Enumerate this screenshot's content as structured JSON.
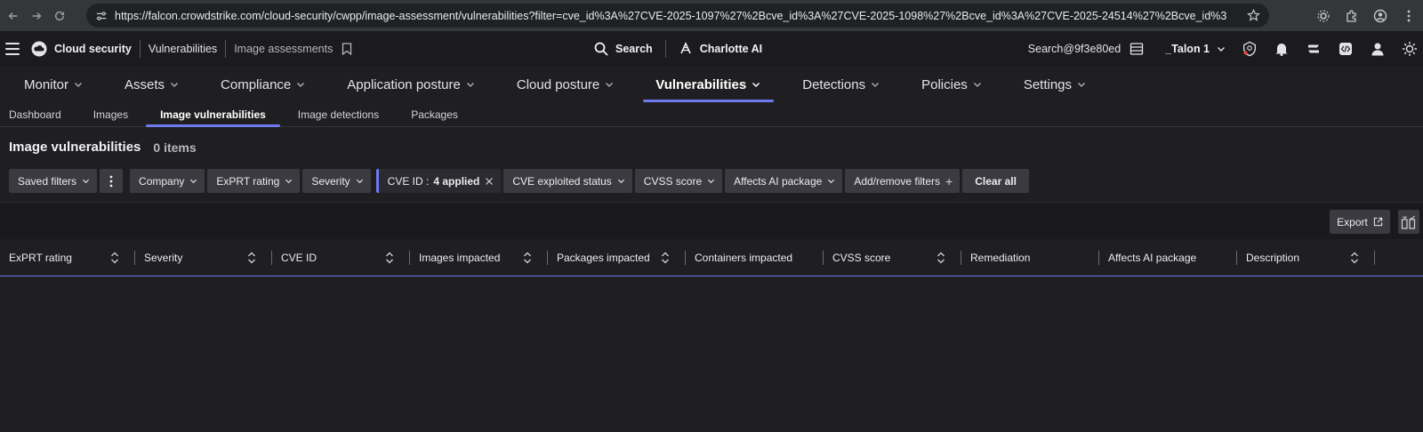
{
  "browser": {
    "url": "https://falcon.crowdstrike.com/cloud-security/cwpp/image-assessment/vulnerabilities?filter=cve_id%3A%27CVE-2025-1097%27%2Bcve_id%3A%27CVE-2025-1098%27%2Bcve_id%3A%27CVE-2025-24514%27%2Bcve_id%3A..."
  },
  "header": {
    "app_name": "Cloud security",
    "crumb": "Vulnerabilities",
    "crumb_sub": "Image assessments",
    "search_label": "Search",
    "ai_label": "Charlotte AI",
    "user_search": "Search@9f3e80ed",
    "tenant": "_Talon 1"
  },
  "main_nav": [
    {
      "label": "Monitor"
    },
    {
      "label": "Assets"
    },
    {
      "label": "Compliance"
    },
    {
      "label": "Application posture"
    },
    {
      "label": "Cloud posture"
    },
    {
      "label": "Vulnerabilities",
      "active": true
    },
    {
      "label": "Detections"
    },
    {
      "label": "Policies"
    },
    {
      "label": "Settings"
    }
  ],
  "sub_nav": [
    {
      "label": "Dashboard"
    },
    {
      "label": "Images"
    },
    {
      "label": "Image vulnerabilities",
      "active": true
    },
    {
      "label": "Image detections"
    },
    {
      "label": "Packages"
    }
  ],
  "page": {
    "title": "Image vulnerabilities",
    "count": "0 items"
  },
  "filters": {
    "saved": "Saved filters",
    "company": "Company",
    "exprt": "ExPRT rating",
    "severity": "Severity",
    "cve_label": "CVE ID :",
    "cve_value": "4 applied",
    "cve_exploited": "CVE exploited status",
    "cvss": "CVSS score",
    "ai_package": "Affects AI package",
    "add_remove": "Add/remove filters",
    "clear_all": "Clear all"
  },
  "toolbar": {
    "export": "Export"
  },
  "columns": [
    {
      "label": "ExPRT rating",
      "sortable": true
    },
    {
      "label": "Severity",
      "sortable": true
    },
    {
      "label": "CVE ID",
      "sortable": true
    },
    {
      "label": "Images impacted",
      "sortable": true
    },
    {
      "label": "Packages impacted",
      "sortable": true
    },
    {
      "label": "Containers impacted",
      "sortable": false
    },
    {
      "label": "CVSS score",
      "sortable": true
    },
    {
      "label": "Remediation",
      "sortable": false
    },
    {
      "label": "Affects AI package",
      "sortable": false
    },
    {
      "label": "Description",
      "sortable": true
    }
  ],
  "colors": {
    "accent": "#6d7bef",
    "background": "#1f1f22",
    "chip": "#3a3a40"
  }
}
